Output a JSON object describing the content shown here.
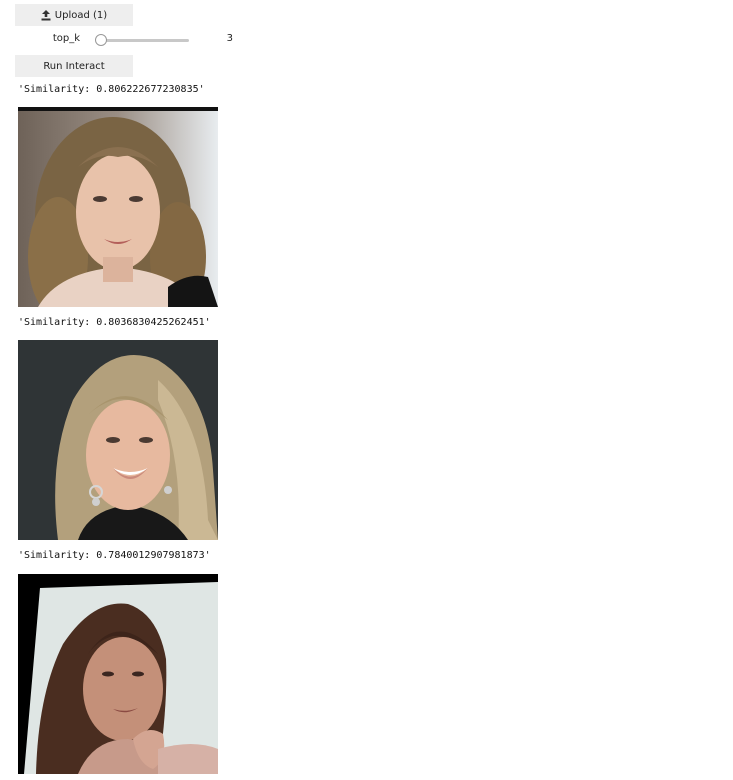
{
  "controls": {
    "upload_label": "Upload (1)",
    "slider": {
      "label": "top_k",
      "value": "3",
      "min": 3,
      "max": 10
    },
    "run_label": "Run Interact"
  },
  "results": [
    {
      "similarity": "'Similarity: 0.806222677230835'",
      "image": "face-photo-1"
    },
    {
      "similarity": "'Similarity: 0.8036830425262451'",
      "image": "face-photo-2"
    },
    {
      "similarity": "'Similarity: 0.7840012907981873'",
      "image": "face-photo-3"
    }
  ],
  "colors": {
    "button_bg": "#eeeeee",
    "slider_track": "#c8c8c8"
  }
}
